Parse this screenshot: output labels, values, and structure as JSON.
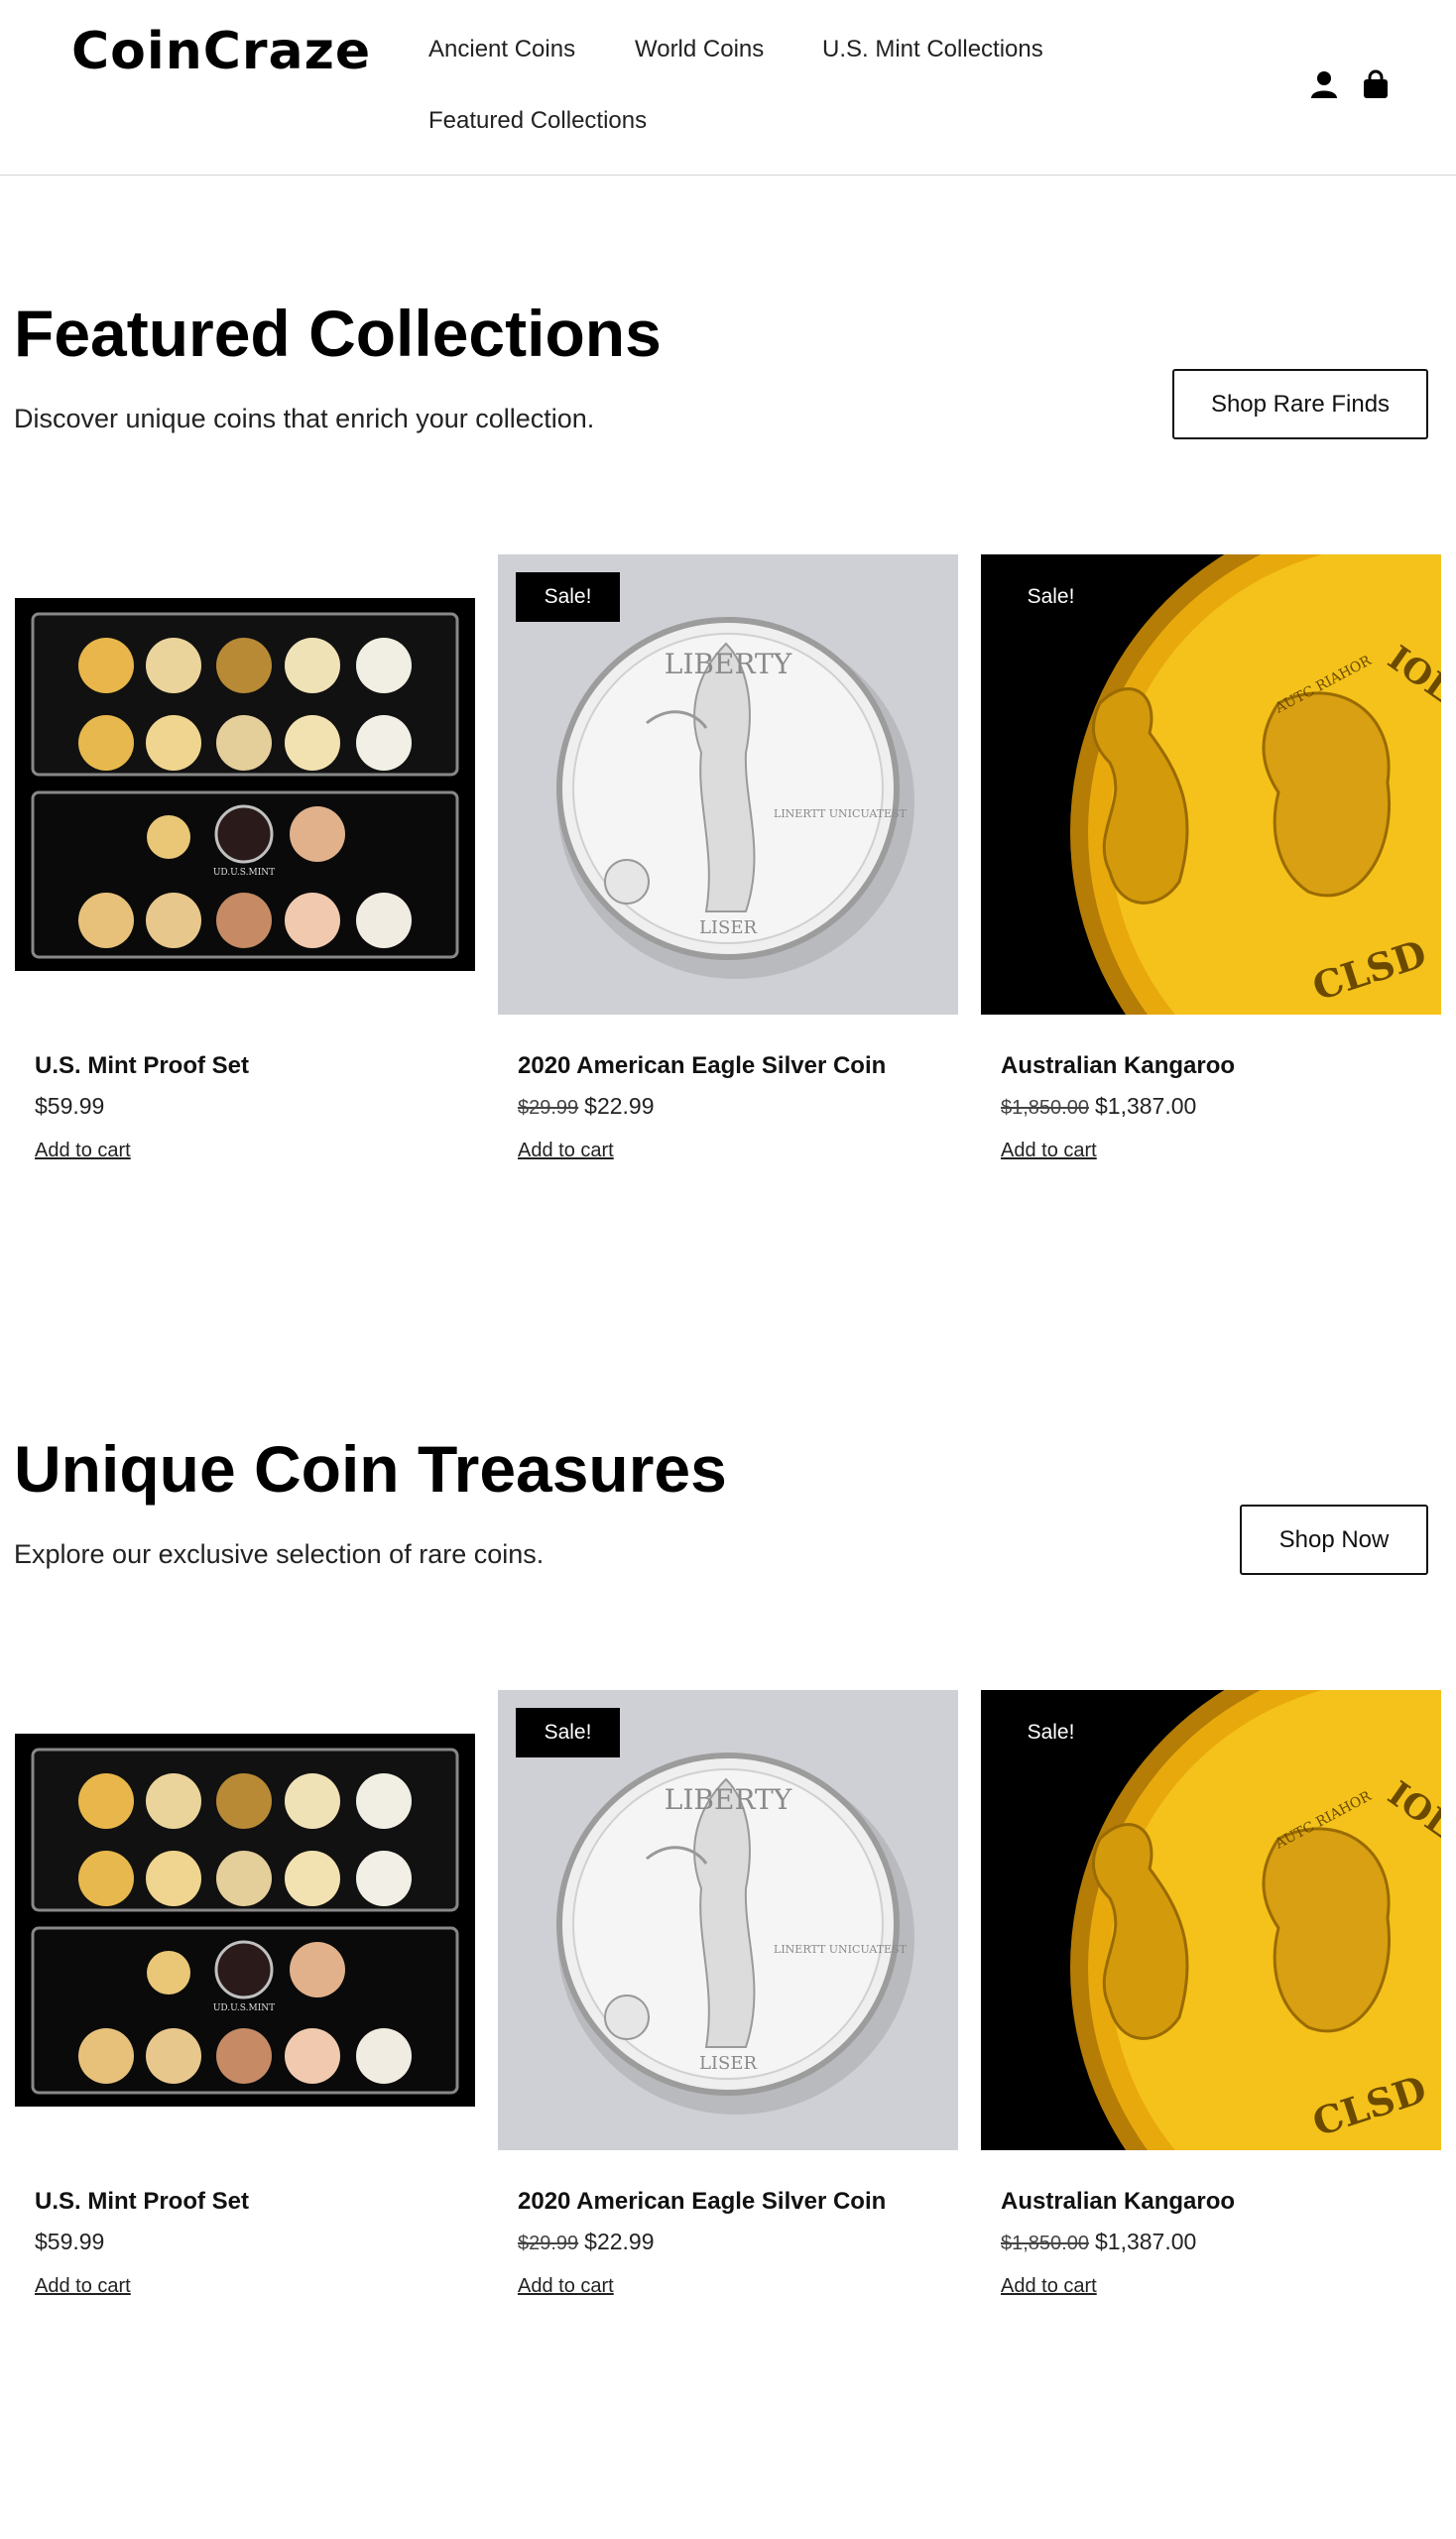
{
  "header": {
    "logo": "CoinCraze",
    "nav": [
      {
        "label": "Ancient Coins"
      },
      {
        "label": "World Coins"
      },
      {
        "label": "U.S. Mint Collections"
      },
      {
        "label": "Featured Collections"
      }
    ],
    "icons": [
      "account-icon",
      "shopping-bag-icon"
    ]
  },
  "sections": [
    {
      "title": "Featured Collections",
      "subtitle": "Discover unique coins that enrich your collection.",
      "button": "Shop Rare Finds",
      "products": [
        {
          "name": "U.S. Mint Proof Set",
          "price": "$59.99",
          "old_price": "",
          "badge": "",
          "cart": "Add to cart",
          "image": "proof-set"
        },
        {
          "name": "2020 American Eagle Silver Coin",
          "price": "$22.99",
          "old_price": "$29.99",
          "badge": "Sale!",
          "cart": "Add to cart",
          "image": "silver-eagle"
        },
        {
          "name": "Australian Kangaroo",
          "price": "$1,387.00",
          "old_price": "$1,850.00",
          "badge": "Sale!",
          "cart": "Add to cart",
          "image": "gold-kangaroo"
        }
      ]
    },
    {
      "title": "Unique Coin Treasures",
      "subtitle": "Explore our exclusive selection of rare coins.",
      "button": "Shop Now",
      "products": [
        {
          "name": "U.S. Mint Proof Set",
          "price": "$59.99",
          "old_price": "",
          "badge": "",
          "cart": "Add to cart",
          "image": "proof-set"
        },
        {
          "name": "2020 American Eagle Silver Coin",
          "price": "$22.99",
          "old_price": "$29.99",
          "badge": "Sale!",
          "cart": "Add to cart",
          "image": "silver-eagle"
        },
        {
          "name": "Australian Kangaroo",
          "price": "$1,387.00",
          "old_price": "$1,850.00",
          "badge": "Sale!",
          "cart": "Add to cart",
          "image": "gold-kangaroo"
        }
      ]
    }
  ],
  "coin_text": {
    "eagle_top": "LIBERTY",
    "eagle_right": "LINERTT UNICUATEST",
    "eagle_bottom": "LISER",
    "kangaroo_ring": "AUTC RIAHOR",
    "kangaroo_right": "IOL",
    "kangaroo_bottom": "CLSD",
    "proof_label": "UD.U.S.MINT"
  }
}
